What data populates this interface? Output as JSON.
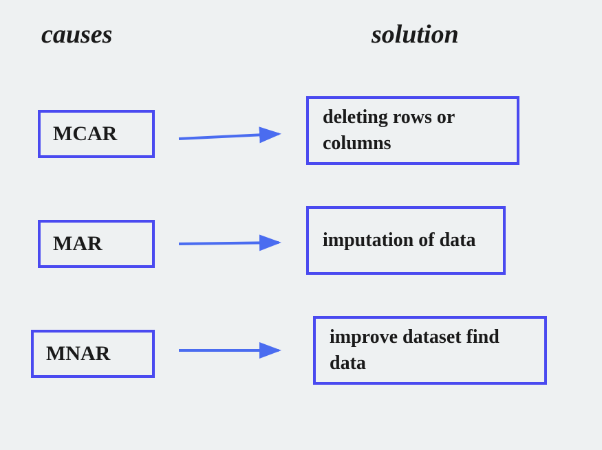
{
  "headers": {
    "causes": "causes",
    "solution": "solution"
  },
  "rows": [
    {
      "cause": "MCAR",
      "solution": "deleting rows or columns"
    },
    {
      "cause": "MAR",
      "solution": "imputation of data"
    },
    {
      "cause": "MNAR",
      "solution": "improve dataset find data"
    }
  ],
  "colors": {
    "stroke": "#4a4af0"
  }
}
